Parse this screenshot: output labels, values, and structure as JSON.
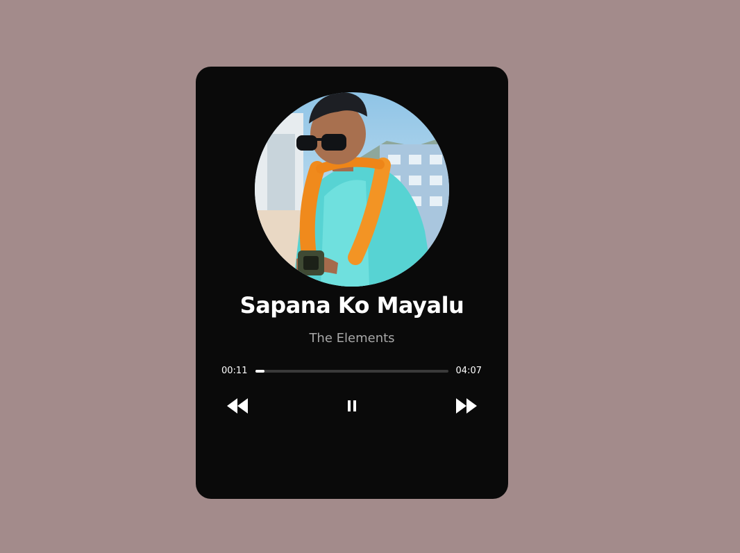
{
  "track": {
    "title": "Sapana Ko Mayalu",
    "artist": "The Elements"
  },
  "progress": {
    "current_time": "00:11",
    "total_time": "04:07",
    "fraction": 0.045
  },
  "controls": {
    "previous_icon": "rewind-icon",
    "play_icon": "pause-icon",
    "next_icon": "fast-forward-icon"
  },
  "colors": {
    "page_background": "#a38b8b",
    "card_background": "#0a0a0a",
    "title": "#ffffff",
    "artist": "#a8a8a8",
    "progress_track": "#3a3a3a",
    "progress_fill": "#ffffff"
  }
}
